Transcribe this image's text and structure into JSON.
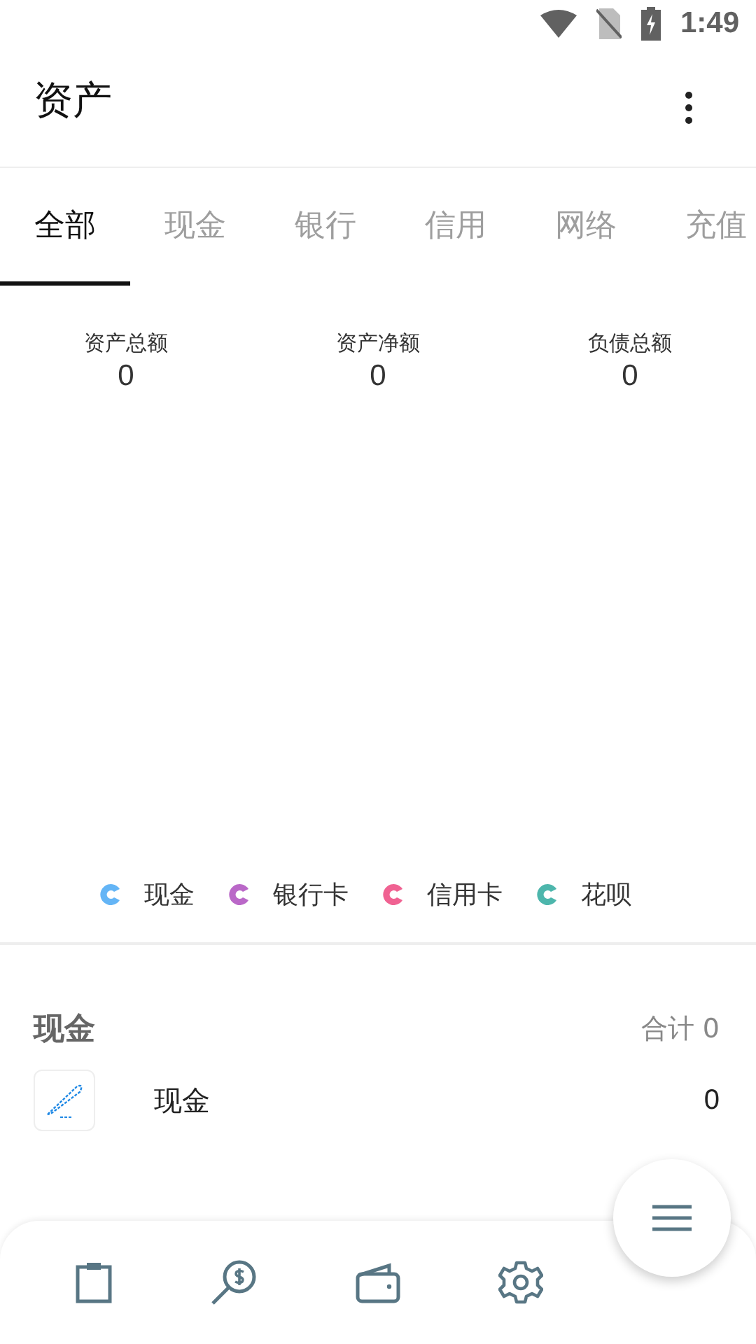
{
  "status_bar": {
    "time": "1:49"
  },
  "app_bar": {
    "title": "资产"
  },
  "tabs": [
    {
      "label": "全部",
      "selected": true
    },
    {
      "label": "现金",
      "selected": false
    },
    {
      "label": "银行",
      "selected": false
    },
    {
      "label": "信用",
      "selected": false
    },
    {
      "label": "网络",
      "selected": false
    },
    {
      "label": "充值",
      "selected": false
    }
  ],
  "summary": [
    {
      "label": "资产总额",
      "value": "0"
    },
    {
      "label": "资产净额",
      "value": "0"
    },
    {
      "label": "负债总额",
      "value": "0"
    }
  ],
  "legend": [
    {
      "label": "现金",
      "color": "#64b5f6"
    },
    {
      "label": "银行卡",
      "color": "#ba68c8"
    },
    {
      "label": "信用卡",
      "color": "#f06292"
    },
    {
      "label": "花呗",
      "color": "#4db6ac"
    }
  ],
  "section": {
    "title": "现金",
    "total": "合计 0"
  },
  "accounts": [
    {
      "name": "现金",
      "amount": "0"
    }
  ]
}
